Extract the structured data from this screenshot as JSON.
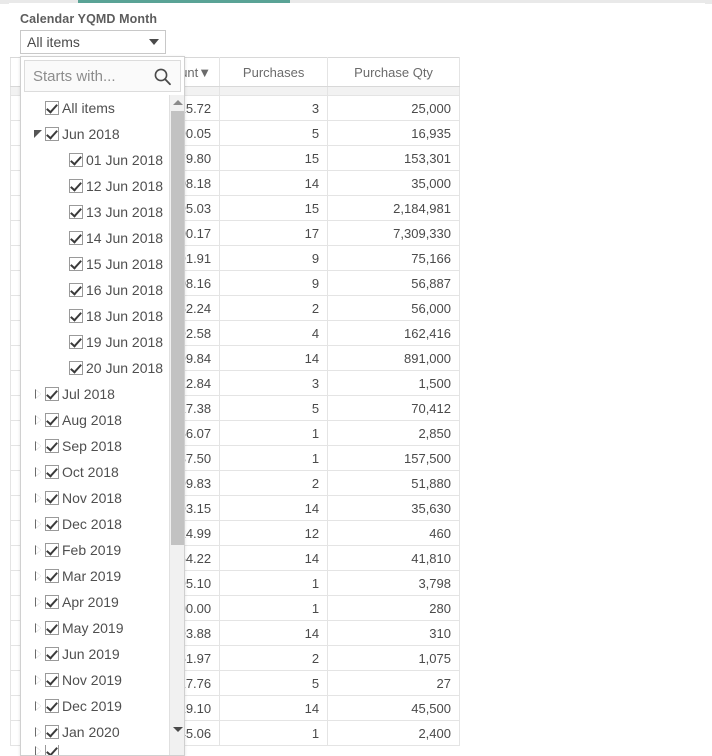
{
  "accent": {
    "color": "#5aa396"
  },
  "filter": {
    "label": "Calendar YQMD Month",
    "selected_value": "All items",
    "caret_icon": "chevron-down-icon",
    "search_placeholder": "Starts with...",
    "search_icon": "search-icon",
    "options": [
      {
        "label": "All items",
        "level": 0,
        "checked": true,
        "twisty": "none"
      },
      {
        "label": "Jun 2018",
        "level": 1,
        "checked": true,
        "twisty": "expanded"
      },
      {
        "label": "01 Jun 2018",
        "level": 2,
        "checked": true,
        "twisty": "none"
      },
      {
        "label": "12 Jun 2018",
        "level": 2,
        "checked": true,
        "twisty": "none"
      },
      {
        "label": "13 Jun 2018",
        "level": 2,
        "checked": true,
        "twisty": "none"
      },
      {
        "label": "14 Jun 2018",
        "level": 2,
        "checked": true,
        "twisty": "none"
      },
      {
        "label": "15 Jun 2018",
        "level": 2,
        "checked": true,
        "twisty": "none"
      },
      {
        "label": "16 Jun 2018",
        "level": 2,
        "checked": true,
        "twisty": "none"
      },
      {
        "label": "18 Jun 2018",
        "level": 2,
        "checked": true,
        "twisty": "none"
      },
      {
        "label": "19 Jun 2018",
        "level": 2,
        "checked": true,
        "twisty": "none"
      },
      {
        "label": "20 Jun 2018",
        "level": 2,
        "checked": true,
        "twisty": "none"
      },
      {
        "label": "Jul 2018",
        "level": 1,
        "checked": true,
        "twisty": "collapsed"
      },
      {
        "label": "Aug 2018",
        "level": 1,
        "checked": true,
        "twisty": "collapsed"
      },
      {
        "label": "Sep 2018",
        "level": 1,
        "checked": true,
        "twisty": "collapsed"
      },
      {
        "label": "Oct 2018",
        "level": 1,
        "checked": true,
        "twisty": "collapsed"
      },
      {
        "label": "Nov 2018",
        "level": 1,
        "checked": true,
        "twisty": "collapsed"
      },
      {
        "label": "Dec 2018",
        "level": 1,
        "checked": true,
        "twisty": "collapsed"
      },
      {
        "label": "Feb 2019",
        "level": 1,
        "checked": true,
        "twisty": "collapsed"
      },
      {
        "label": "Mar 2019",
        "level": 1,
        "checked": true,
        "twisty": "collapsed"
      },
      {
        "label": "Apr 2019",
        "level": 1,
        "checked": true,
        "twisty": "collapsed"
      },
      {
        "label": "May 2019",
        "level": 1,
        "checked": true,
        "twisty": "collapsed"
      },
      {
        "label": "Jun 2019",
        "level": 1,
        "checked": true,
        "twisty": "collapsed"
      },
      {
        "label": "Nov 2019",
        "level": 1,
        "checked": true,
        "twisty": "collapsed"
      },
      {
        "label": "Dec 2019",
        "level": 1,
        "checked": true,
        "twisty": "collapsed"
      },
      {
        "label": "Jan 2020",
        "level": 1,
        "checked": true,
        "twisty": "collapsed"
      }
    ],
    "scrollbar": {
      "up_icon": "scroll-up-arrow-icon",
      "down_icon": "scroll-down-arrow-icon"
    }
  },
  "table": {
    "columns": [
      {
        "key": "dim",
        "label": ""
      },
      {
        "key": "amount",
        "label": "Invoice line amount",
        "sort_indicator": "▼"
      },
      {
        "key": "purch",
        "label": "Purchases"
      },
      {
        "key": "qty",
        "label": "Purchase Qty"
      }
    ],
    "rows": [
      {
        "amount": "6,376,815.72",
        "purch": "3",
        "qty": "25,000"
      },
      {
        "amount": "4,828,290.05",
        "purch": "5",
        "qty": "16,935"
      },
      {
        "amount": "4,264,879.80",
        "purch": "15",
        "qty": "153,301"
      },
      {
        "amount": "3,228,008.18",
        "purch": "14",
        "qty": "35,000"
      },
      {
        "amount": "2,068,395.03",
        "purch": "15",
        "qty": "2,184,981"
      },
      {
        "amount": "1,677,100.17",
        "purch": "17",
        "qty": "7,309,330"
      },
      {
        "amount": "1,136,591.91",
        "purch": "9",
        "qty": "75,166"
      },
      {
        "amount": "886,108.16",
        "purch": "9",
        "qty": "56,887"
      },
      {
        "amount": "267,362.24",
        "purch": "2",
        "qty": "56,000"
      },
      {
        "amount": "266,492.58",
        "purch": "4",
        "qty": "162,416"
      },
      {
        "amount": "217,799.84",
        "purch": "14",
        "qty": "891,000"
      },
      {
        "amount": "143,522.84",
        "purch": "3",
        "qty": "1,500"
      },
      {
        "amount": "93,817.38",
        "purch": "5",
        "qty": "70,412"
      },
      {
        "amount": "85,356.07",
        "purch": "1",
        "qty": "2,850"
      },
      {
        "amount": "55,987.50",
        "purch": "1",
        "qty": "157,500"
      },
      {
        "amount": "41,999.83",
        "purch": "2",
        "qty": "51,880"
      },
      {
        "amount": "34,193.15",
        "purch": "14",
        "qty": "35,630"
      },
      {
        "amount": "33,924.99",
        "purch": "12",
        "qty": "460"
      },
      {
        "amount": "33,264.22",
        "purch": "14",
        "qty": "41,810"
      },
      {
        "amount": "28,295.10",
        "purch": "1",
        "qty": "3,798"
      },
      {
        "amount": "25,200.00",
        "purch": "1",
        "qty": "280"
      },
      {
        "amount": "22,793.88",
        "purch": "14",
        "qty": "310"
      },
      {
        "amount": "18,451.97",
        "purch": "2",
        "qty": "1,075"
      },
      {
        "amount": "13,217.76",
        "purch": "5",
        "qty": "27"
      },
      {
        "amount": "11,719.10",
        "purch": "14",
        "qty": "45,500"
      },
      {
        "amount": "4,245.06",
        "purch": "1",
        "qty": "2,400"
      }
    ]
  }
}
